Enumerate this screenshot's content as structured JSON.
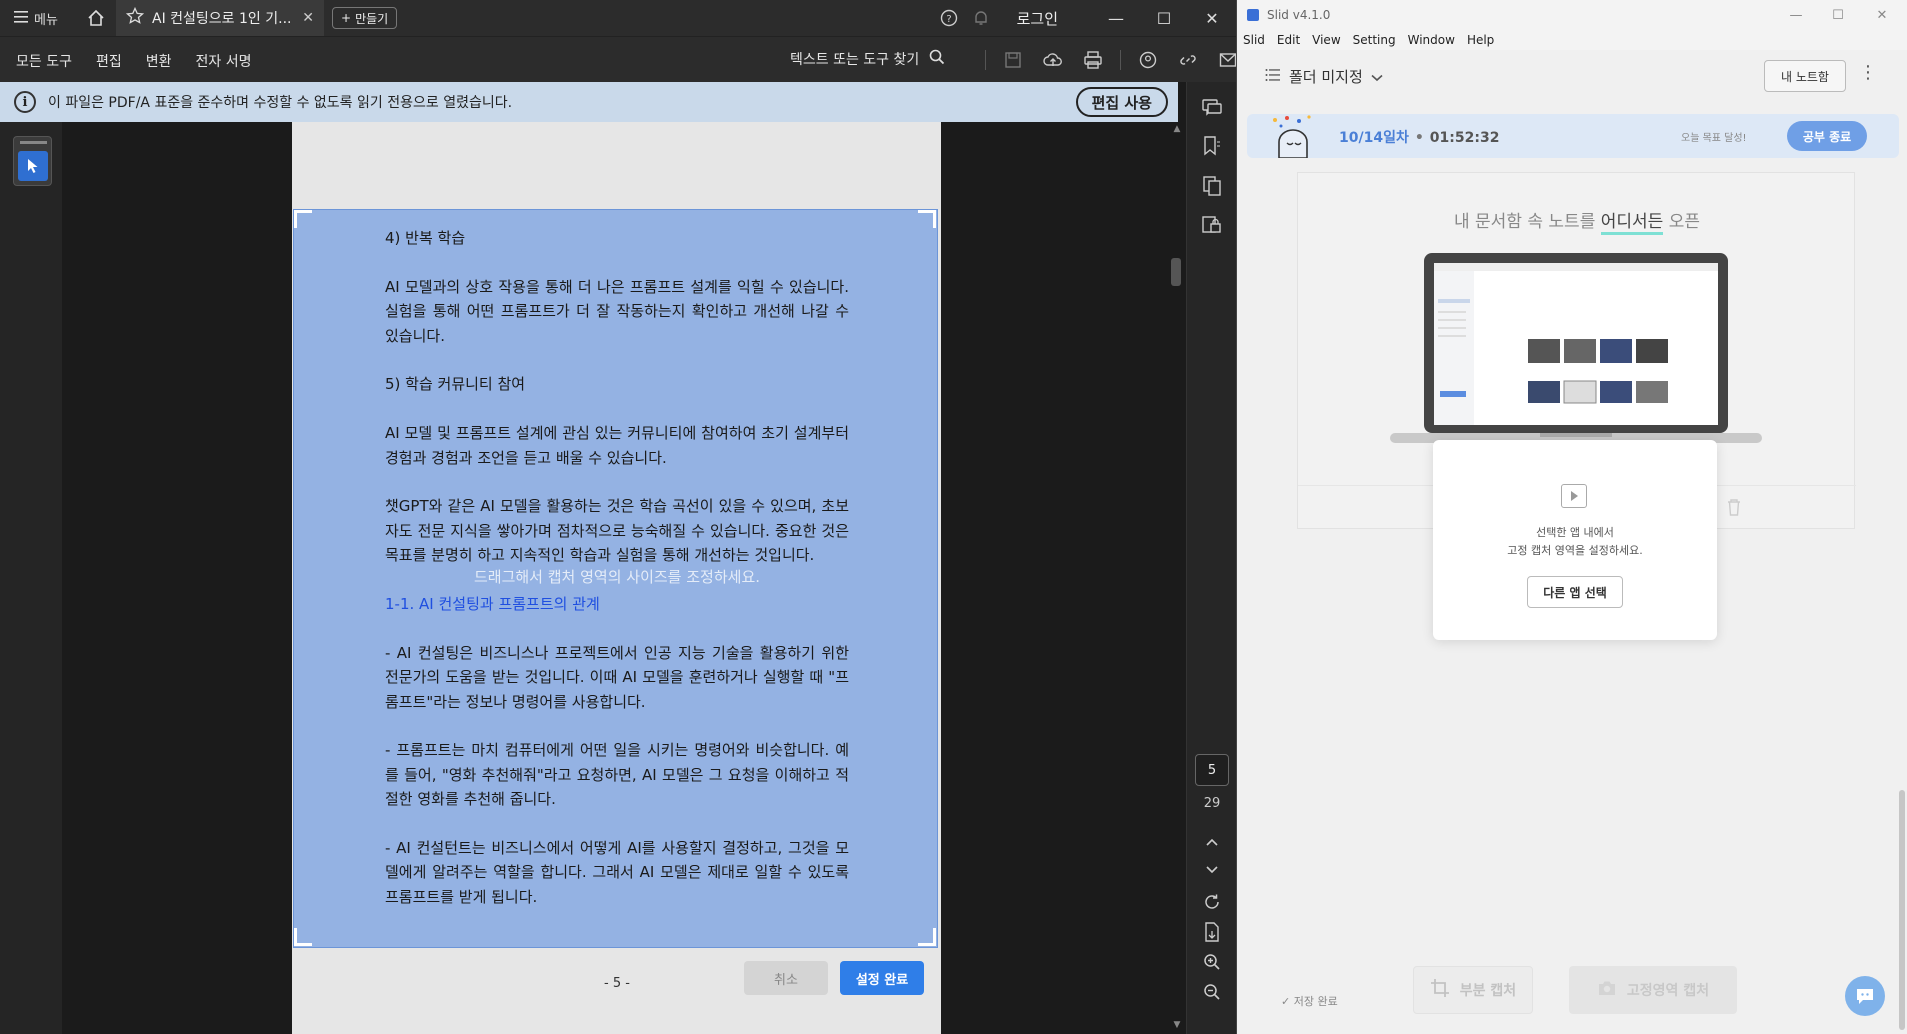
{
  "acrobat": {
    "titlebar": {
      "menu_label": "메뉴",
      "tab_title": "AI 컨설팅으로 1인 기...",
      "new_label": "만들기",
      "login_label": "로그인"
    },
    "toolbar": {
      "menus": [
        "모든 도구",
        "편집",
        "변환",
        "전자 서명"
      ],
      "search_label": "텍스트 또는 도구 찾기"
    },
    "infobar": {
      "message": "이 파일은 PDF/A 표준을 준수하며 수정할 수 없도록 읽기 전용으로 열렸습니다.",
      "edit_button": "편집 사용"
    },
    "document": {
      "paragraphs": [
        "4) 반복 학습",
        "AI 모델과의 상호 작용을 통해 더 나은 프롬프트 설계를 익힐 수 있습니다. 실험을 통해 어떤 프롬프트가 더 잘 작동하는지 확인하고 개선해 나갈 수 있습니다.",
        "5) 학습 커뮤니티 참여",
        "AI 모델 및 프롬프트 설계에 관심 있는 커뮤니티에 참여하여 초기 설계부터 경험과 경험과 조언을 듣고 배울 수 있습니다.",
        "챗GPT와 같은 AI 모델을 활용하는 것은 학습 곡선이 있을 수 있으며, 초보자도 전문 지식을 쌓아가며 점차적으로 능숙해질 수 있습니다. 중요한 것은 목표를 분명히 하고 지속적인 학습과 실험을 통해 개선하는 것입니다.",
        "1-1. AI 컨설팅과 프롬프트의 관계",
        "- AI 컨설팅은 비즈니스나 프로젝트에서 인공 지능 기술을 활용하기 위한 전문가의 도움을 받는 것입니다. 이때 AI 모델을 훈련하거나 실행할 때 \"프롬프트\"라는 정보나 명령어를 사용합니다.",
        "- 프롬프트는 마치 컴퓨터에게 어떤 일을 시키는 명령어와 비슷합니다. 예를 들어, \"영화 추천해줘\"라고 요청하면, AI 모델은 그 요청을 이해하고 적절한 영화를 추천해 줍니다.",
        "- AI 컨설턴트는 비즈니스에서 어떻게 AI를 사용할지 결정하고, 그것을 모델에게 알려주는 역할을 합니다. 그래서 AI 모델은 제대로 일할 수 있도록 프롬프트를 받게 됩니다."
      ],
      "overlay_message": "드래그해서 캡처 영역의 사이즈를 조정하세요.",
      "page_footer": "- 5 -",
      "cancel_button": "취소",
      "done_button": "설정 완료"
    },
    "pager": {
      "current": "5",
      "total": "29"
    }
  },
  "slid": {
    "window_title": "Slid v4.1.0",
    "menu": [
      "Slid",
      "Edit",
      "View",
      "Setting",
      "Window",
      "Help"
    ],
    "folder_label": "폴더 미지정",
    "my_note_button": "내 노트함",
    "study": {
      "day": "10/14일차",
      "dot": "•",
      "time": "01:52:32",
      "goal": "오늘 목표 달성!",
      "end_button": "공부 종료"
    },
    "card": {
      "head_prefix": "내 문서함 속 노트를 ",
      "head_emphasis": "어디서든",
      "head_suffix": " 오픈"
    },
    "popup": {
      "line1": "선택한 앱 내에서",
      "line2": "고정 캡처 영역을 설정하세요.",
      "other_app_button": "다른 앱 선택"
    },
    "saved_label": "저장 완료",
    "partial_capture": "부분 캡처",
    "fixed_capture": "고정영역 캡처"
  }
}
